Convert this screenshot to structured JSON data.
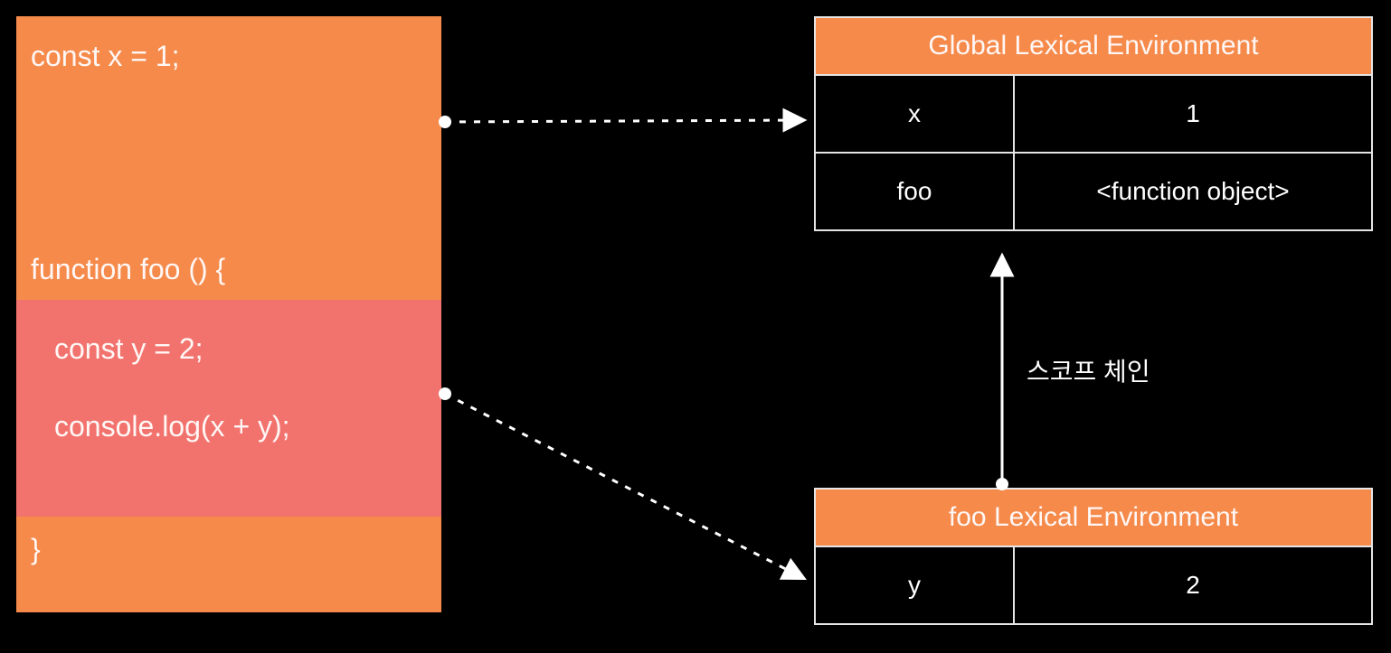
{
  "code": {
    "line1": "const x = 1;",
    "fn_decl": "function foo () {",
    "inner_line1": "const y = 2;",
    "inner_line2": "console.log(x + y);",
    "close_brace": "}"
  },
  "global_env": {
    "title": "Global Lexical Environment",
    "rows": [
      {
        "key": "x",
        "val": "1"
      },
      {
        "key": "foo",
        "val": "<function object>"
      }
    ]
  },
  "foo_env": {
    "title": "foo Lexical Environment",
    "rows": [
      {
        "key": "y",
        "val": "2"
      }
    ]
  },
  "chain_label": "스코프 체인"
}
